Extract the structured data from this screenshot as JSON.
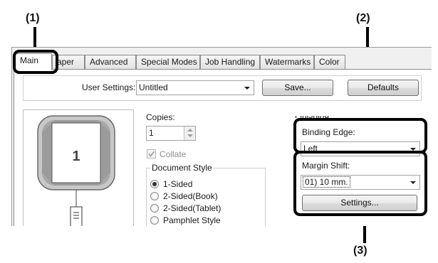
{
  "callouts": {
    "c1": "(1)",
    "c2": "(2)",
    "c3": "(3)"
  },
  "tabs": [
    {
      "label": "Main"
    },
    {
      "label": "aper"
    },
    {
      "label": "Advanced"
    },
    {
      "label": "Special Modes"
    },
    {
      "label": "Job Handling"
    },
    {
      "label": "Watermarks"
    },
    {
      "label": "Color"
    }
  ],
  "user_settings": {
    "label": "User Settings:",
    "value": "Untitled",
    "save_label": "Save...",
    "defaults_label": "Defaults"
  },
  "preview": {
    "page_number": "1"
  },
  "copies": {
    "label": "Copies:",
    "value": "1"
  },
  "collate": {
    "label": "Collate",
    "checked": true
  },
  "document_style": {
    "title": "Document Style",
    "options": [
      {
        "label": "1-Sided",
        "selected": true
      },
      {
        "label": "2-Sided(Book)",
        "selected": false
      },
      {
        "label": "2-Sided(Tablet)",
        "selected": false
      },
      {
        "label": "Pamphlet Style",
        "selected": false
      }
    ]
  },
  "finishing": {
    "title": "Finishing",
    "binding_edge_label": "Binding Edge:",
    "binding_edge_value": "Left",
    "margin_shift_label": "Margin Shift:",
    "margin_shift_value": "01) 10 mm.",
    "settings_label": "Settings..."
  }
}
